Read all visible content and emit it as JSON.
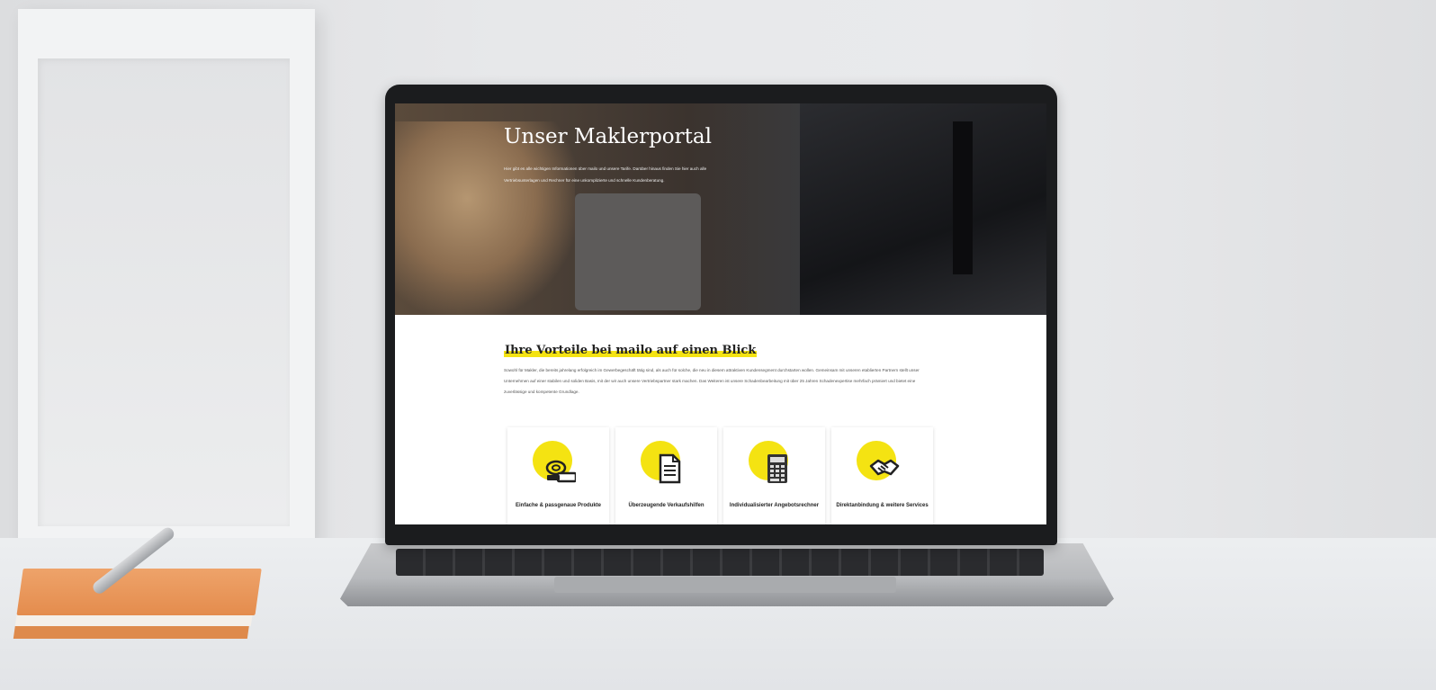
{
  "hero": {
    "title": "Unser Maklerportal",
    "subtitle": "Hier gibt es alle wichtigen Informationen über mailo und unsere Tarife. Darüber hinaus finden Sie hier auch alle Vertriebsunterlagen und Rechner für eine unkomplizierte und schnelle Kundenberatung."
  },
  "benefits": {
    "heading": "Ihre Vorteile bei mailo auf einen Blick",
    "text": "Sowohl für Makler, die bereits jahrelang erfolgreich im Gewerbegeschäft tätig sind, als auch für solche, die neu in diesem attraktiven Kundensegment durchstarten wollen. Gemeinsam mit unseren etablierten Partnern stellt unser Unternehmen auf einer stabilen und soliden Basis, mit der wir auch unsere Vertriebspartner stark machen. Das Weiteren ist unsere Schadenbearbeitung mit über 25 Jahren Schadenexpertise mehrfach prämiert und bietet eine zuverlässige und kompetente Grundlage.",
    "cards": [
      {
        "label": "Einfache & passgenaue Produkte",
        "icon": "coins-icon"
      },
      {
        "label": "Überzeugende Verkaufshilfen",
        "icon": "document-icon"
      },
      {
        "label": "Individualisierter Angebotsrechner",
        "icon": "calculator-icon"
      },
      {
        "label": "Direktanbindung & weitere Services",
        "icon": "handshake-icon"
      }
    ]
  },
  "colors": {
    "accent": "#f4e312"
  }
}
